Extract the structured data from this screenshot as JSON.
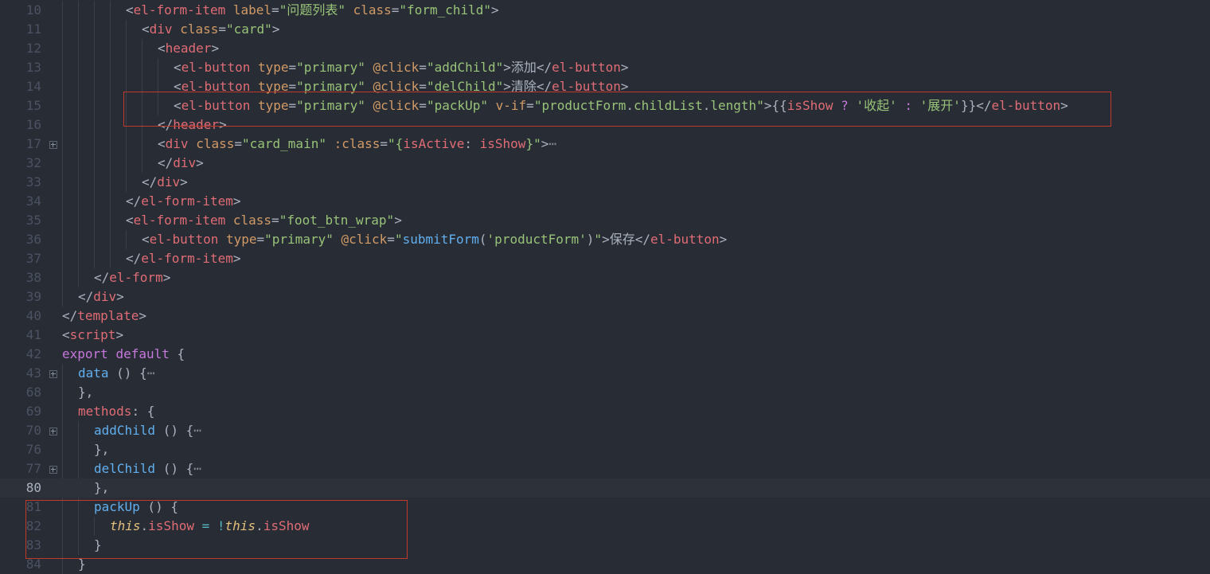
{
  "lines": [
    {
      "num": "10",
      "indent": 4,
      "tokens": [
        [
          "text",
          "<"
        ],
        [
          "tag",
          "el-form-item"
        ],
        [
          "text",
          " "
        ],
        [
          "attr",
          "label"
        ],
        [
          "text",
          "="
        ],
        [
          "str",
          "\"问题列表\""
        ],
        [
          "text",
          " "
        ],
        [
          "attr",
          "class"
        ],
        [
          "text",
          "="
        ],
        [
          "str",
          "\"form_child\""
        ],
        [
          "text",
          ">"
        ]
      ]
    },
    {
      "num": "11",
      "indent": 5,
      "tokens": [
        [
          "text",
          "<"
        ],
        [
          "tag",
          "div"
        ],
        [
          "text",
          " "
        ],
        [
          "attr",
          "class"
        ],
        [
          "text",
          "="
        ],
        [
          "str",
          "\"card\""
        ],
        [
          "text",
          ">"
        ]
      ]
    },
    {
      "num": "12",
      "indent": 6,
      "tokens": [
        [
          "text",
          "<"
        ],
        [
          "tag",
          "header"
        ],
        [
          "text",
          ">"
        ]
      ]
    },
    {
      "num": "13",
      "indent": 7,
      "tokens": [
        [
          "text",
          "<"
        ],
        [
          "tag",
          "el-button"
        ],
        [
          "text",
          " "
        ],
        [
          "attr",
          "type"
        ],
        [
          "text",
          "="
        ],
        [
          "str",
          "\"primary\""
        ],
        [
          "text",
          " "
        ],
        [
          "attr",
          "@click"
        ],
        [
          "text",
          "="
        ],
        [
          "str",
          "\"addChild\""
        ],
        [
          "text",
          ">添加</"
        ],
        [
          "tag",
          "el-button"
        ],
        [
          "text",
          ">"
        ]
      ]
    },
    {
      "num": "14",
      "indent": 7,
      "tokens": [
        [
          "text",
          "<"
        ],
        [
          "tag",
          "el-button"
        ],
        [
          "text",
          " "
        ],
        [
          "attr",
          "type"
        ],
        [
          "text",
          "="
        ],
        [
          "str",
          "\"primary\""
        ],
        [
          "text",
          " "
        ],
        [
          "attr",
          "@click"
        ],
        [
          "text",
          "="
        ],
        [
          "str",
          "\"delChild\""
        ],
        [
          "text",
          ">清除</"
        ],
        [
          "tag",
          "el-button"
        ],
        [
          "text",
          ">"
        ]
      ]
    },
    {
      "num": "15",
      "indent": 7,
      "tokens": [
        [
          "text",
          "<"
        ],
        [
          "tag",
          "el-button"
        ],
        [
          "text",
          " "
        ],
        [
          "attr",
          "type"
        ],
        [
          "text",
          "="
        ],
        [
          "str",
          "\"primary\""
        ],
        [
          "text",
          " "
        ],
        [
          "attr",
          "@click"
        ],
        [
          "text",
          "="
        ],
        [
          "str",
          "\"packUp\""
        ],
        [
          "text",
          " "
        ],
        [
          "attr",
          "v-if"
        ],
        [
          "text",
          "="
        ],
        [
          "str",
          "\"productForm"
        ],
        [
          "text",
          "."
        ],
        [
          "str",
          "childList"
        ],
        [
          "text",
          "."
        ],
        [
          "str",
          "length\""
        ],
        [
          "text",
          ">{{"
        ],
        [
          "prop",
          "isShow"
        ],
        [
          "text",
          " "
        ],
        [
          "kw",
          "?"
        ],
        [
          "text",
          " "
        ],
        [
          "str",
          "'收起'"
        ],
        [
          "text",
          " "
        ],
        [
          "kw",
          ":"
        ],
        [
          "text",
          " "
        ],
        [
          "str",
          "'展开'"
        ],
        [
          "text",
          "}}</"
        ],
        [
          "tag",
          "el-button"
        ],
        [
          "text",
          ">"
        ]
      ]
    },
    {
      "num": "16",
      "indent": 6,
      "tokens": [
        [
          "text",
          "</"
        ],
        [
          "tag",
          "header"
        ],
        [
          "text",
          ">"
        ]
      ]
    },
    {
      "num": "17",
      "indent": 6,
      "fold": true,
      "tokens": [
        [
          "text",
          "<"
        ],
        [
          "tag",
          "div"
        ],
        [
          "text",
          " "
        ],
        [
          "attr",
          "class"
        ],
        [
          "text",
          "="
        ],
        [
          "str",
          "\"card_main\""
        ],
        [
          "text",
          " "
        ],
        [
          "attr",
          ":class"
        ],
        [
          "text",
          "="
        ],
        [
          "str",
          "\"{"
        ],
        [
          "prop",
          "isActive"
        ],
        [
          "text",
          ": "
        ],
        [
          "prop",
          "isShow"
        ],
        [
          "str",
          "}\""
        ],
        [
          "text",
          ">"
        ],
        [
          "fold",
          "⋯"
        ]
      ]
    },
    {
      "num": "32",
      "indent": 6,
      "tokens": [
        [
          "text",
          "</"
        ],
        [
          "tag",
          "div"
        ],
        [
          "text",
          ">"
        ]
      ]
    },
    {
      "num": "33",
      "indent": 5,
      "tokens": [
        [
          "text",
          "</"
        ],
        [
          "tag",
          "div"
        ],
        [
          "text",
          ">"
        ]
      ]
    },
    {
      "num": "34",
      "indent": 4,
      "tokens": [
        [
          "text",
          "</"
        ],
        [
          "tag",
          "el-form-item"
        ],
        [
          "text",
          ">"
        ]
      ]
    },
    {
      "num": "35",
      "indent": 4,
      "tokens": [
        [
          "text",
          "<"
        ],
        [
          "tag",
          "el-form-item"
        ],
        [
          "text",
          " "
        ],
        [
          "attr",
          "class"
        ],
        [
          "text",
          "="
        ],
        [
          "str",
          "\"foot_btn_wrap\""
        ],
        [
          "text",
          ">"
        ]
      ]
    },
    {
      "num": "36",
      "indent": 5,
      "tokens": [
        [
          "text",
          "<"
        ],
        [
          "tag",
          "el-button"
        ],
        [
          "text",
          " "
        ],
        [
          "attr",
          "type"
        ],
        [
          "text",
          "="
        ],
        [
          "str",
          "\"primary\""
        ],
        [
          "text",
          " "
        ],
        [
          "attr",
          "@click"
        ],
        [
          "text",
          "="
        ],
        [
          "str",
          "\""
        ],
        [
          "fn",
          "submitForm"
        ],
        [
          "text",
          "("
        ],
        [
          "str",
          "'productForm'"
        ],
        [
          "text",
          ")"
        ],
        [
          "str",
          "\""
        ],
        [
          "text",
          ">保存</"
        ],
        [
          "tag",
          "el-button"
        ],
        [
          "text",
          ">"
        ]
      ]
    },
    {
      "num": "37",
      "indent": 4,
      "tokens": [
        [
          "text",
          "</"
        ],
        [
          "tag",
          "el-form-item"
        ],
        [
          "text",
          ">"
        ]
      ]
    },
    {
      "num": "38",
      "indent": 2,
      "tokens": [
        [
          "text",
          "</"
        ],
        [
          "tag",
          "el-form"
        ],
        [
          "text",
          ">"
        ]
      ]
    },
    {
      "num": "39",
      "indent": 1,
      "tokens": [
        [
          "text",
          "</"
        ],
        [
          "tag",
          "div"
        ],
        [
          "text",
          ">"
        ]
      ]
    },
    {
      "num": "40",
      "indent": 0,
      "tokens": [
        [
          "text",
          "</"
        ],
        [
          "tag",
          "template"
        ],
        [
          "text",
          ">"
        ]
      ]
    },
    {
      "num": "41",
      "indent": 0,
      "tokens": [
        [
          "text",
          "<"
        ],
        [
          "tag",
          "script"
        ],
        [
          "text",
          ">"
        ]
      ]
    },
    {
      "num": "42",
      "indent": 0,
      "tokens": [
        [
          "kw",
          "export"
        ],
        [
          "text",
          " "
        ],
        [
          "kw",
          "default"
        ],
        [
          "text",
          " {"
        ]
      ]
    },
    {
      "num": "43",
      "indent": 1,
      "fold": true,
      "tokens": [
        [
          "fn",
          "data"
        ],
        [
          "text",
          " () {"
        ],
        [
          "fold",
          "⋯"
        ]
      ]
    },
    {
      "num": "68",
      "indent": 1,
      "tokens": [
        [
          "text",
          "},"
        ]
      ]
    },
    {
      "num": "69",
      "indent": 1,
      "tokens": [
        [
          "prop",
          "methods"
        ],
        [
          "text",
          ": {"
        ]
      ]
    },
    {
      "num": "70",
      "indent": 2,
      "fold": true,
      "tokens": [
        [
          "fn",
          "addChild"
        ],
        [
          "text",
          " () {"
        ],
        [
          "fold",
          "⋯"
        ]
      ]
    },
    {
      "num": "76",
      "indent": 2,
      "tokens": [
        [
          "text",
          "},"
        ]
      ]
    },
    {
      "num": "77",
      "indent": 2,
      "fold": true,
      "tokens": [
        [
          "fn",
          "delChild"
        ],
        [
          "text",
          " () {"
        ],
        [
          "fold",
          "⋯"
        ]
      ]
    },
    {
      "num": "80",
      "indent": 2,
      "current": true,
      "tokens": [
        [
          "text",
          "},"
        ]
      ]
    },
    {
      "num": "81",
      "indent": 2,
      "tokens": [
        [
          "fn",
          "packUp"
        ],
        [
          "text",
          " () {"
        ]
      ]
    },
    {
      "num": "82",
      "indent": 3,
      "tokens": [
        [
          "this",
          "this"
        ],
        [
          "text",
          "."
        ],
        [
          "prop",
          "isShow"
        ],
        [
          "text",
          " "
        ],
        [
          "op",
          "="
        ],
        [
          "text",
          " "
        ],
        [
          "op",
          "!"
        ],
        [
          "this",
          "this"
        ],
        [
          "text",
          "."
        ],
        [
          "prop",
          "isShow"
        ]
      ]
    },
    {
      "num": "83",
      "indent": 2,
      "tokens": [
        [
          "text",
          "}"
        ]
      ]
    },
    {
      "num": "84",
      "indent": 1,
      "tokens": [
        [
          "text",
          "}"
        ]
      ]
    }
  ]
}
